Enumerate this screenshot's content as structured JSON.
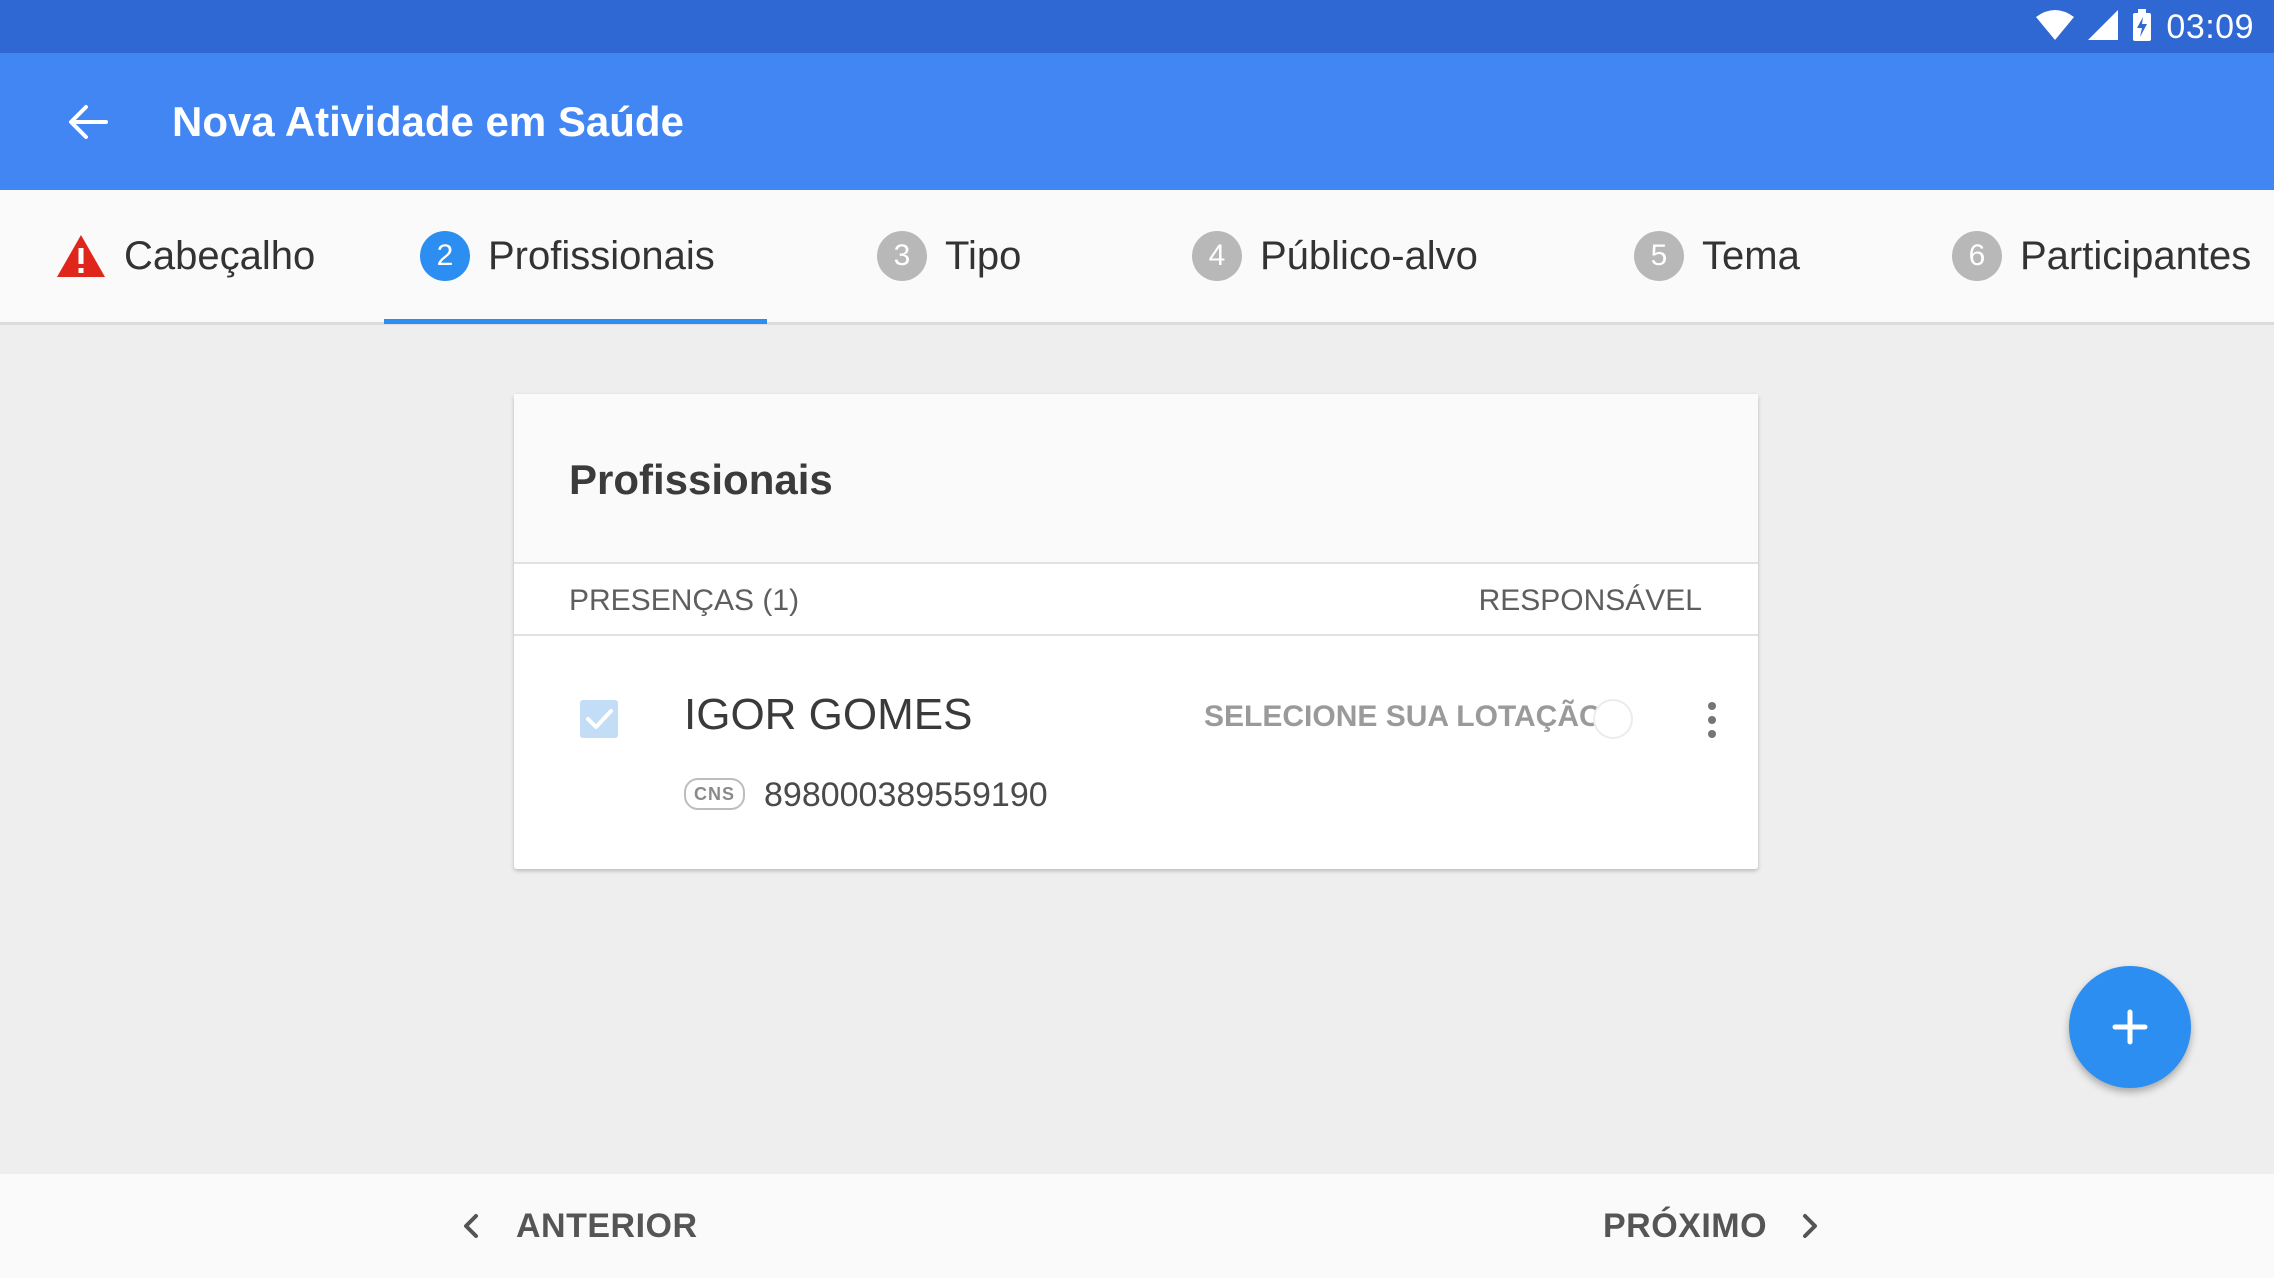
{
  "status_bar": {
    "time": "03:09"
  },
  "app_bar": {
    "title": "Nova Atividade em Saúde"
  },
  "tabs": [
    {
      "label": "Cabeçalho",
      "state": "warning",
      "icon": "warning-icon"
    },
    {
      "number": "2",
      "label": "Profissionais",
      "state": "active"
    },
    {
      "number": "3",
      "label": "Tipo",
      "state": "inactive"
    },
    {
      "number": "4",
      "label": "Público-alvo",
      "state": "inactive"
    },
    {
      "number": "5",
      "label": "Tema",
      "state": "inactive"
    },
    {
      "number": "6",
      "label": "Participantes",
      "state": "inactive"
    }
  ],
  "card": {
    "title": "Profissionais",
    "list_header": {
      "left": "PRESENÇAS (1)",
      "right": "RESPONSÁVEL"
    },
    "professional": {
      "name": "IGOR GOMES",
      "cns_label": "CNS",
      "cns_number": "898000389559190",
      "lotacao_action": "SELECIONE SUA LOTAÇÃO",
      "present": true,
      "responsible": false
    }
  },
  "fab": {
    "icon": "plus-icon"
  },
  "bottom_nav": {
    "previous": "ANTERIOR",
    "next": "PRÓXIMO"
  },
  "colors": {
    "status_bar": "#2f67d3",
    "app_bar": "#4286f4",
    "accent": "#2b8ef0",
    "warning": "#e0251b"
  }
}
